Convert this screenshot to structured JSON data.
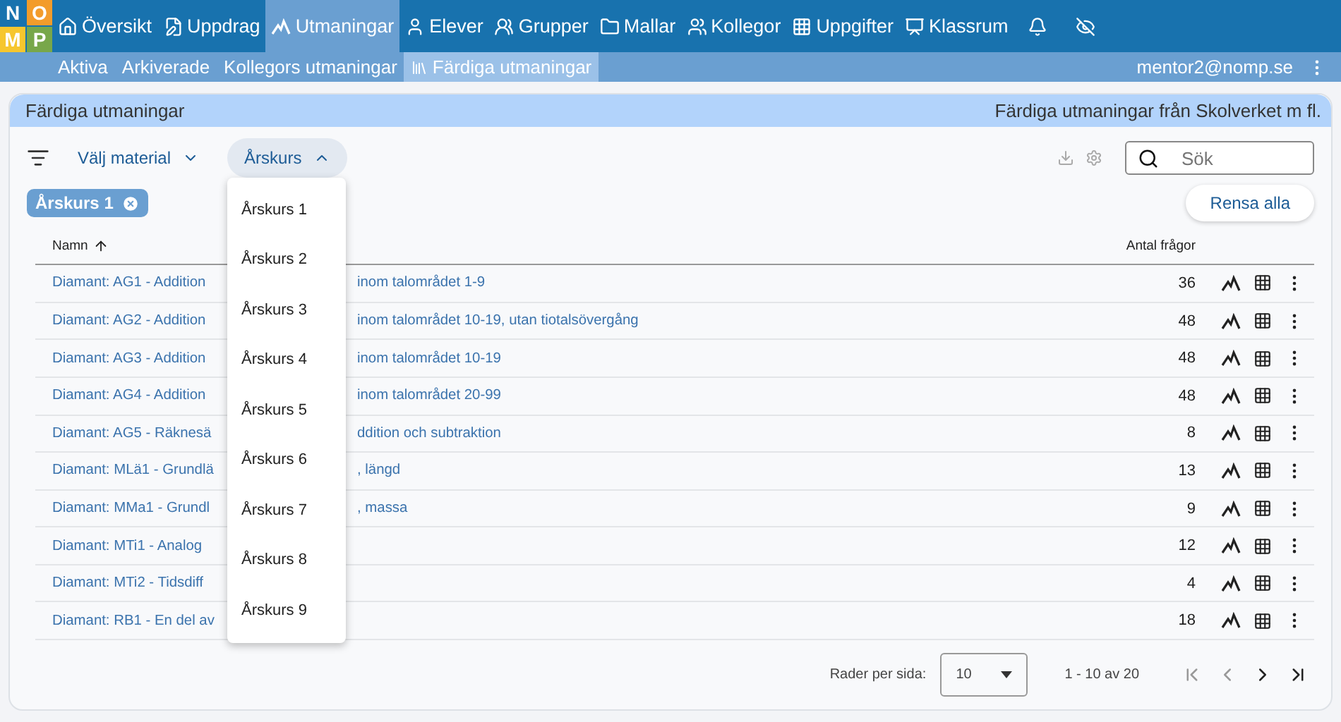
{
  "logo": [
    "N",
    "O",
    "M",
    "P"
  ],
  "nav": [
    {
      "label": "Översikt",
      "selected": false
    },
    {
      "label": "Uppdrag",
      "selected": false
    },
    {
      "label": "Utmaningar",
      "selected": true
    },
    {
      "label": "Elever",
      "selected": false
    },
    {
      "label": "Grupper",
      "selected": false
    },
    {
      "label": "Mallar",
      "selected": false
    },
    {
      "label": "Kollegor",
      "selected": false
    },
    {
      "label": "Uppgifter",
      "selected": false
    },
    {
      "label": "Klassrum",
      "selected": false
    }
  ],
  "subnav": [
    {
      "label": "Aktiva",
      "selected": false
    },
    {
      "label": "Arkiverade",
      "selected": false
    },
    {
      "label": "Kollegors utmaningar",
      "selected": false
    },
    {
      "label": "Färdiga utmaningar",
      "selected": true
    }
  ],
  "user": "mentor2@nomp.se",
  "card": {
    "title": "Färdiga utmaningar",
    "subtitle": "Färdiga utmaningar från Skolverket m fl."
  },
  "filters": [
    {
      "label": "Välj material",
      "expanded": false
    },
    {
      "label": "Årskurs",
      "expanded": true
    }
  ],
  "search": {
    "placeholder": "Sök"
  },
  "chips": [
    "Årskurs 1"
  ],
  "clear_button": "Rensa alla",
  "dropdown": [
    "Årskurs 1",
    "Årskurs 2",
    "Årskurs 3",
    "Årskurs 4",
    "Årskurs 5",
    "Årskurs 6",
    "Årskurs 7",
    "Årskurs 8",
    "Årskurs 9"
  ],
  "table": {
    "columns": [
      "Namn",
      "Antal frågor"
    ],
    "rows": [
      {
        "name_start": "Diamant: AG1 - Addition",
        "name_end": "inom talområdet 1-9",
        "count": "36"
      },
      {
        "name_start": "Diamant: AG2 - Addition",
        "name_end": "inom talområdet 10-19, utan tiotalsövergång",
        "count": "48"
      },
      {
        "name_start": "Diamant: AG3 - Addition",
        "name_end": "inom talområdet 10-19",
        "count": "48"
      },
      {
        "name_start": "Diamant: AG4 - Addition",
        "name_end": "inom talområdet 20-99",
        "count": "48"
      },
      {
        "name_start": "Diamant: AG5 - Räknesä",
        "name_end": "ddition och subtraktion",
        "count": "8"
      },
      {
        "name_start": "Diamant: MLä1 - Grundlä",
        "name_end": ", längd",
        "count": "13"
      },
      {
        "name_start": "Diamant: MMa1 - Grundl",
        "name_end": ", massa",
        "count": "9"
      },
      {
        "name_start": "Diamant: MTi1 - Analog",
        "count": "12"
      },
      {
        "name_start": "Diamant: MTi2 - Tidsdiff",
        "count": "4"
      },
      {
        "name_start": "Diamant: RB1 - En del av",
        "count": "18"
      }
    ]
  },
  "pagination": {
    "rows_label": "Rader per sida:",
    "rows_value": "10",
    "range": "1 - 10 av 20"
  }
}
